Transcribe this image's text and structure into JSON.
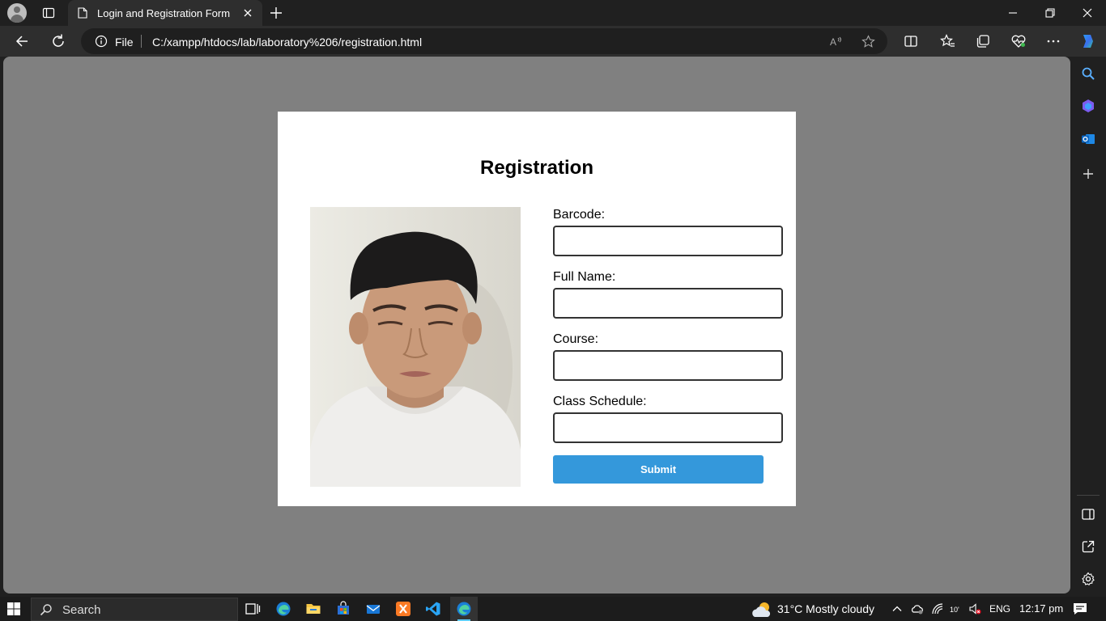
{
  "browser": {
    "tab_title": "Login and Registration Form",
    "url_scheme_label": "File",
    "url": "C:/xampp/htdocs/lab/laboratory%206/registration.html"
  },
  "page": {
    "heading": "Registration",
    "photo_alt": "Student photo",
    "fields": [
      {
        "label": "Barcode:",
        "value": ""
      },
      {
        "label": "Full Name:",
        "value": ""
      },
      {
        "label": "Course:",
        "value": ""
      },
      {
        "label": "Class Schedule:",
        "value": ""
      }
    ],
    "submit_label": "Submit",
    "submit_color": "#3498db",
    "background_color": "#808080"
  },
  "taskbar": {
    "search_placeholder": "Search",
    "weather": "31°C  Mostly cloudy",
    "language": "ENG",
    "time": "12:17 pm"
  },
  "colors": {
    "accent": "#60cdff",
    "chrome_dark": "#202020",
    "chrome_mid": "#2e2e2e"
  }
}
